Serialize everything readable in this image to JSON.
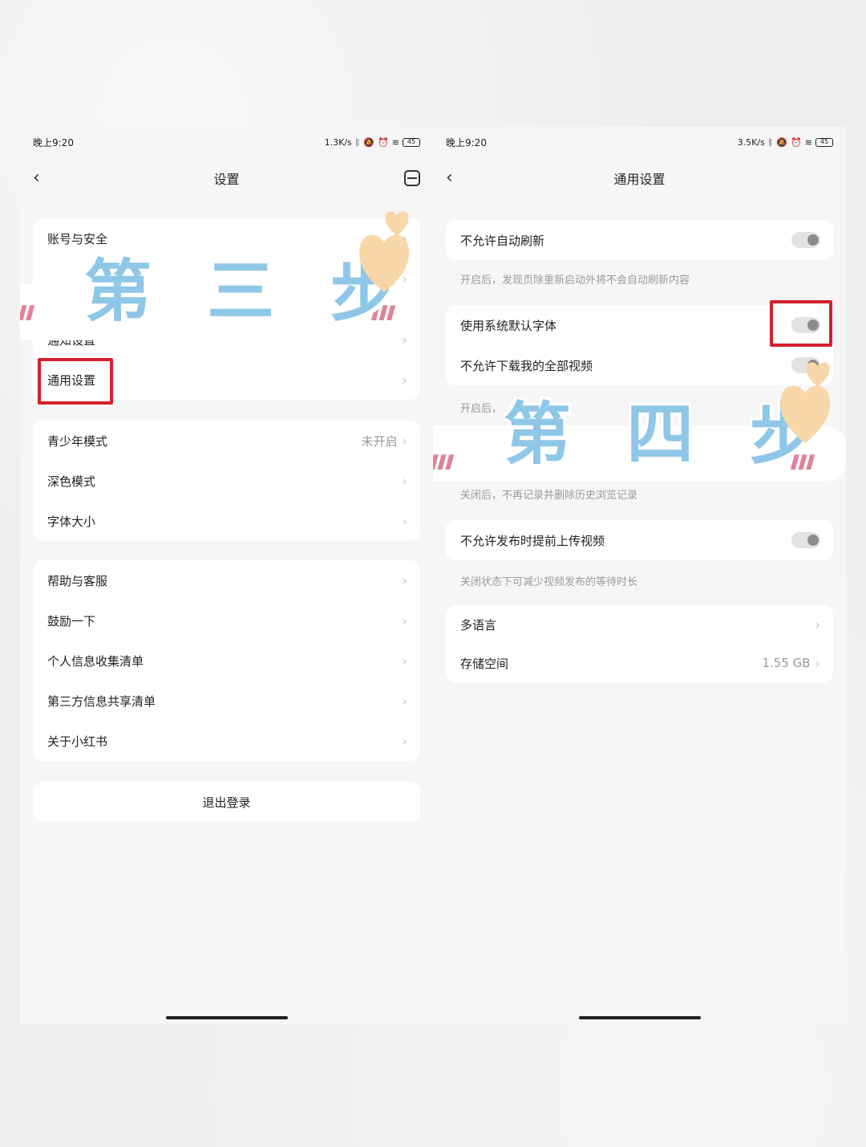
{
  "left": {
    "status": {
      "time": "晚上9:20",
      "speed": "1.3K/s",
      "battery": "45"
    },
    "title": "设置",
    "group1": [
      {
        "label": "账号与安全"
      },
      {
        "label": ""
      },
      {
        "label": "通知设置"
      },
      {
        "label": "通用设置"
      }
    ],
    "group2": [
      {
        "label": "青少年模式",
        "value": "未开启"
      },
      {
        "label": "深色模式"
      },
      {
        "label": "字体大小"
      }
    ],
    "group3": [
      {
        "label": "帮助与客服"
      },
      {
        "label": "鼓励一下"
      },
      {
        "label": "个人信息收集清单"
      },
      {
        "label": "第三方信息共享清单"
      },
      {
        "label": "关于小红书"
      }
    ],
    "logout": "退出登录",
    "step": "第 三 步"
  },
  "right": {
    "status": {
      "time": "晚上9:20",
      "speed": "3.5K/s",
      "battery": "45"
    },
    "title": "通用设置",
    "auto_refresh": {
      "label": "不允许自动刷新",
      "desc": "开启后，发现页除重新启动外将不会自动刷新内容"
    },
    "system_font": {
      "label": "使用系统默认字体"
    },
    "download_videos": {
      "label": "不允许下载我的全部视频",
      "desc": "开启后，"
    },
    "history": {
      "desc": "关闭后，不再记录并删除历史浏览记录"
    },
    "preupload": {
      "label": "不允许发布时提前上传视频",
      "desc": "关闭状态下可减少视频发布的等待时长"
    },
    "language": {
      "label": "多语言"
    },
    "storage": {
      "label": "存储空间",
      "value": "1.55 GB"
    },
    "step": "第 四 步"
  },
  "colors": {
    "highlight": "#d6202d",
    "step_text": "#8fc7e8",
    "heart": "#f7d7a8",
    "marks": "#e0829a"
  },
  "icons": [
    "back-icon",
    "scan-icon",
    "chevron-right-icon",
    "toggle-switch",
    "heart-icon",
    "bluetooth-icon",
    "wifi-icon",
    "battery-icon",
    "alarm-icon",
    "mute-icon"
  ]
}
